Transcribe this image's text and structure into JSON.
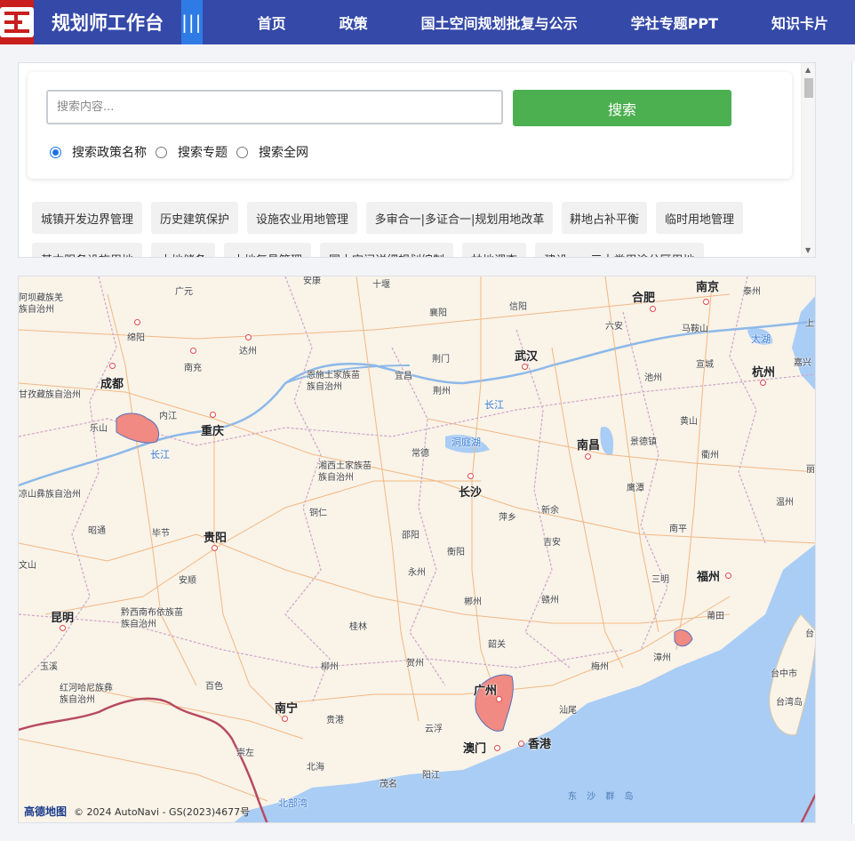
{
  "app": {
    "title": "规划师工作台"
  },
  "nav": {
    "menu_icon": "menu-icon",
    "items": [
      {
        "label": "首页"
      },
      {
        "label": "政策"
      },
      {
        "label": "国土空间规划批复与公示"
      },
      {
        "label": "学社专题PPT"
      },
      {
        "label": "知识卡片"
      }
    ]
  },
  "search": {
    "placeholder": "搜索内容...",
    "button_label": "搜索",
    "options": [
      {
        "label": "搜索政策名称",
        "checked": true
      },
      {
        "label": "搜索专题",
        "checked": false
      },
      {
        "label": "搜索全网",
        "checked": false
      }
    ],
    "tags": [
      "城镇开发边界管理",
      "历史建筑保护",
      "设施农业用地管理",
      "多审合一|多证合一|规划用地改革",
      "耕地占补平衡",
      "临时用地管理",
      "基本服务设施用地",
      "土地储备",
      "土地复垦管理",
      "国土空间详细规划编制",
      "林地调查",
      "建设——三大类用途分区用地"
    ]
  },
  "map": {
    "colors": {
      "land": "#f9f3e8",
      "water": "#a9cdf5",
      "road": "#f2b27a",
      "border": "#b74b5f",
      "highlight": "#f08a82"
    },
    "cities_major": [
      "成都",
      "重庆",
      "贵阳",
      "昆明",
      "南宁",
      "长沙",
      "武汉",
      "南昌",
      "福州",
      "杭州",
      "合肥",
      "南京",
      "广州",
      "澳门",
      "香港"
    ],
    "cities_minor": [
      "广元",
      "绵阳",
      "达州",
      "南充",
      "内江",
      "乐山",
      "毕节",
      "昭通",
      "安顺",
      "黔西南布依族苗族自治州",
      "玉溪",
      "百色",
      "崇左",
      "北海",
      "贵港",
      "柳州",
      "桂林",
      "铜仁",
      "邵阳",
      "衡阳",
      "永州",
      "郴州",
      "韶关",
      "赣州",
      "吉安",
      "萍乡",
      "新余",
      "鹰潭",
      "景德镇",
      "黄山",
      "衢州",
      "宣城",
      "池州",
      "马鞍山",
      "六安",
      "信阳",
      "襄阳",
      "荆门",
      "荆州",
      "宜昌",
      "常德",
      "湘西土家族苗族自治州",
      "恩施土家族苗族自治州",
      "阿坝藏族羌族自治州",
      "甘孜藏族自治州",
      "凉山彝族自治州",
      "红河哈尼族彝族自治州",
      "泰州",
      "嘉兴",
      "温州",
      "南平",
      "三明",
      "莆田",
      "漳州",
      "梅州",
      "贺州",
      "云浮",
      "汕尾",
      "茂名",
      "阳江",
      "台中市",
      "台湾岛",
      "十堰",
      "安康",
      "上海",
      "台",
      "文山",
      "丽水"
    ],
    "water_labels": [
      "长江",
      "洞庭湖",
      "太湖",
      "北部湾",
      "东 沙 群 岛"
    ],
    "footer": {
      "logo": "高德地图",
      "copyright": "© 2024 AutoNavi - GS(2023)4677号"
    }
  }
}
